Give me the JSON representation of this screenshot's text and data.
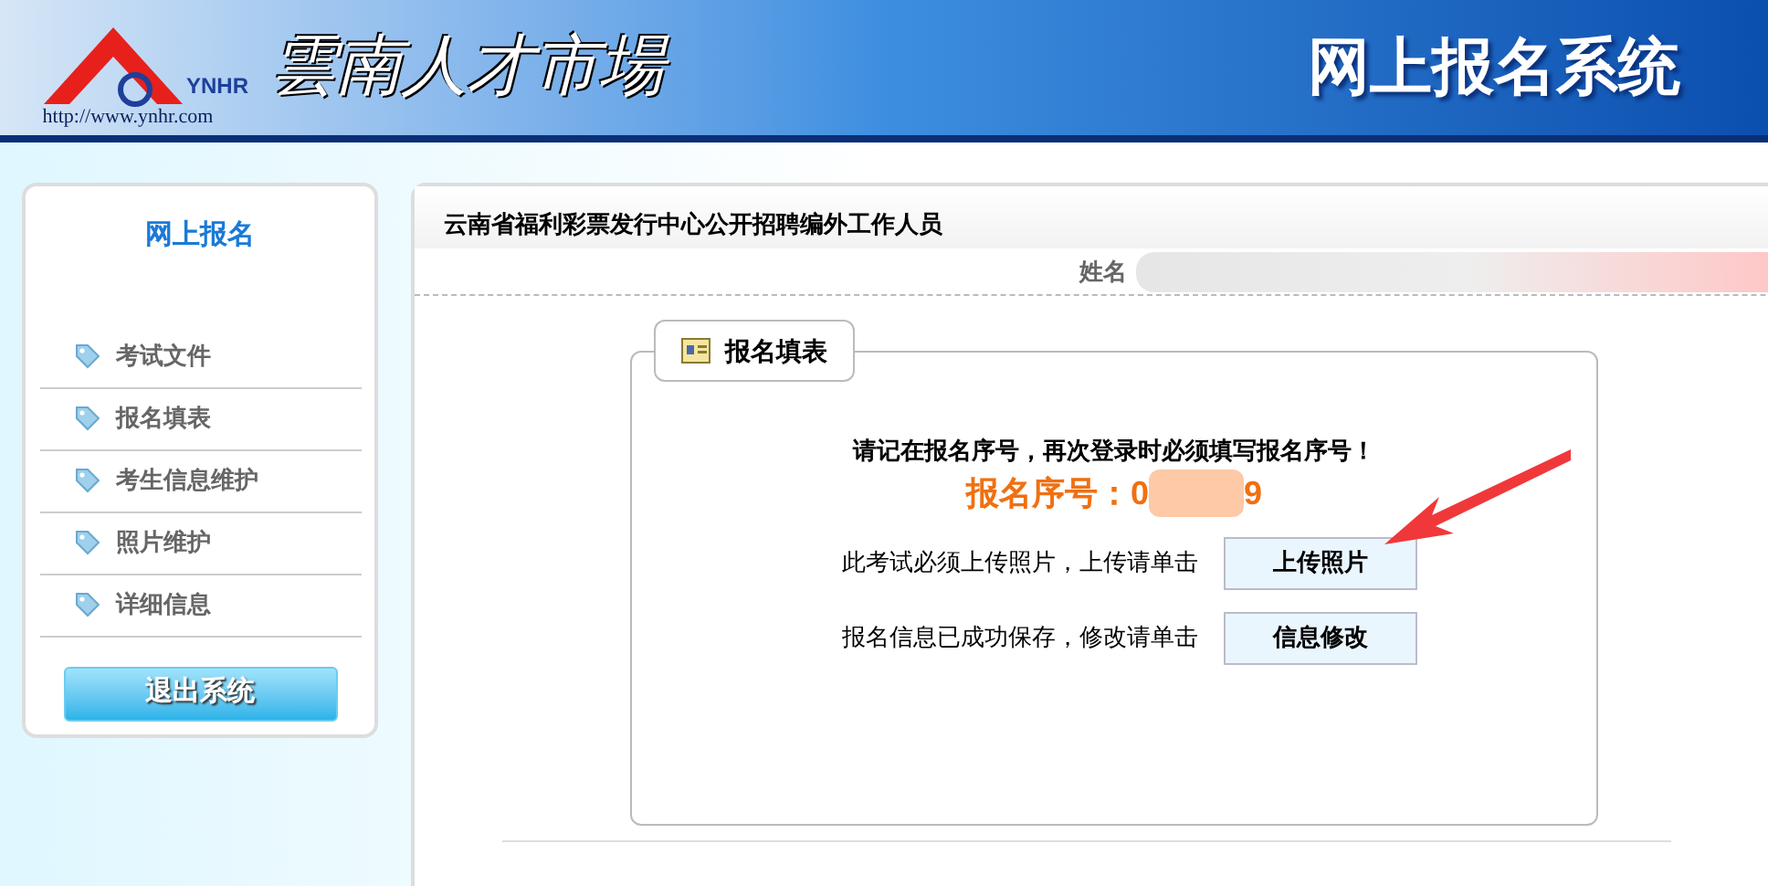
{
  "header": {
    "logo_mark": "YNHR",
    "logo_url": "http://www.ynhr.com",
    "brand": "雲南人才市場",
    "title": "网上报名系统"
  },
  "sidebar": {
    "title": "网上报名",
    "items": [
      {
        "label": "考试文件"
      },
      {
        "label": "报名填表"
      },
      {
        "label": "考生信息维护"
      },
      {
        "label": "照片维护"
      },
      {
        "label": "详细信息"
      }
    ],
    "logout": "退出系统"
  },
  "main": {
    "heading": "云南省福利彩票发行中心公开招聘编外工作人员",
    "name_label": "姓名",
    "form": {
      "tab": "报名填表",
      "notice": "请记在报名序号，再次登录时必须填写报名序号！",
      "serial_label": "报名序号：",
      "serial_start": "0",
      "serial_end": "9",
      "actions": [
        {
          "text": "此考试必须上传照片，上传请单击",
          "button": "上传照片"
        },
        {
          "text": "报名信息已成功保存，修改请单击",
          "button": "信息修改"
        }
      ]
    }
  }
}
